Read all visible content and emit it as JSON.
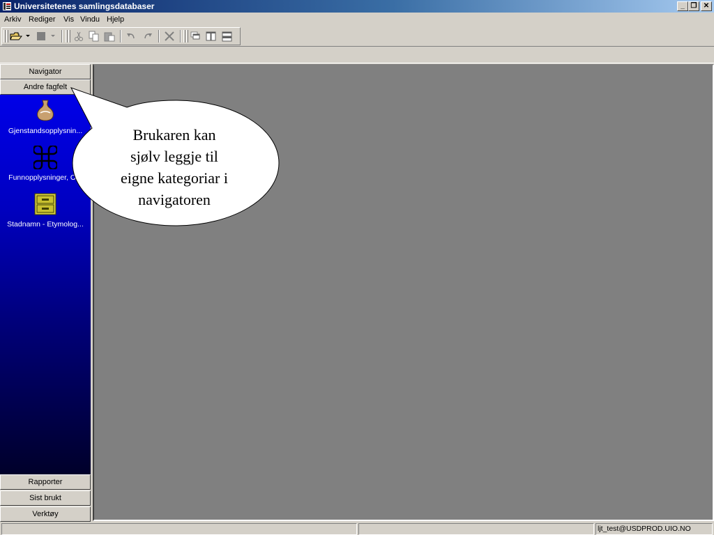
{
  "window": {
    "title": "Universitetenes samlingsdatabaser",
    "minimize": "_",
    "restore": "❐",
    "close": "✕"
  },
  "menu": {
    "items": [
      "Arkiv",
      "Rediger",
      "Vis",
      "Vindu",
      "Hjelp"
    ]
  },
  "toolbar": {
    "icons": [
      "open-folder-icon",
      "dropdown-arrow-icon",
      "stop-icon",
      "dropdown-arrow-icon",
      "cut-icon",
      "copy-icon",
      "paste-icon",
      "undo-icon",
      "redo-icon",
      "delete-icon",
      "cascade-icon",
      "tile-vertical-icon",
      "tile-horizontal-icon"
    ]
  },
  "navigator": {
    "top_buttons": [
      "Navigator",
      "Andre fagfelt"
    ],
    "items": [
      {
        "label": "Gjenstandsopplysnin...",
        "icon": "vase-icon"
      },
      {
        "label": "Funnopplysninger, O...",
        "icon": "command-icon"
      },
      {
        "label": "Stadnamn - Etymolog...",
        "icon": "file-cabinet-icon"
      }
    ],
    "bottom_buttons": [
      "Rapporter",
      "Sist brukt",
      "Verktøy"
    ]
  },
  "callout": {
    "lines": [
      "Brukaren kan",
      "sjølv leggje til",
      "eigne kategoriar i",
      "navigatoren"
    ]
  },
  "statusbar": {
    "pane1": "",
    "pane2": "",
    "user": "ljt_test@USDPROD.UIO.NO"
  },
  "colors": {
    "titlebar_start": "#0a246a",
    "titlebar_end": "#a6caf0",
    "face": "#d4d0c8",
    "mdi_background": "#808080",
    "nav_panel_top": "#0000e8",
    "nav_panel_bottom": "#00002a"
  }
}
